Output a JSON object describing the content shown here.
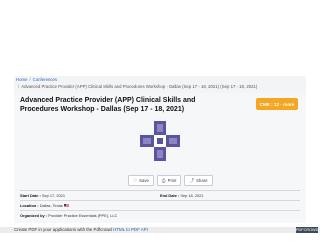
{
  "breadcrumb": {
    "home": "Home",
    "separator": "/",
    "conferences": "Conferences",
    "current": "Advanced Practice Provider (APP) Clinical Skills and Procedures Workshop - Dallas (Sep 17 - 18, 2021) (Sep 17 - 18, 2021)"
  },
  "event": {
    "title": "Advanced Practice Provider (APP) Clinical Skills and Procedures Workshop - Dallas (Sep 17 - 18, 2021)",
    "cme_badge": "CME : 12 · more",
    "logo_icon": "medical-cross-logo",
    "logo_color": "#5b559f"
  },
  "actions": {
    "save": "Save",
    "print": "Print",
    "share": "Share"
  },
  "details": {
    "start_label": "Start Date :",
    "start_value": "Sep 17, 2021",
    "end_label": "End Date :",
    "end_value": "Sep 18, 2021",
    "location_label": "Location :",
    "location_value": "Dallas, Texas",
    "organizer_label": "Organized by :",
    "organizer_value": "Provider Practice Essentials (PPE), LLC"
  },
  "footer": {
    "text": "Create PDF in your applications with the Pdfcrowd",
    "link": "HTML to PDF API",
    "badge": "PDFCROWD"
  }
}
